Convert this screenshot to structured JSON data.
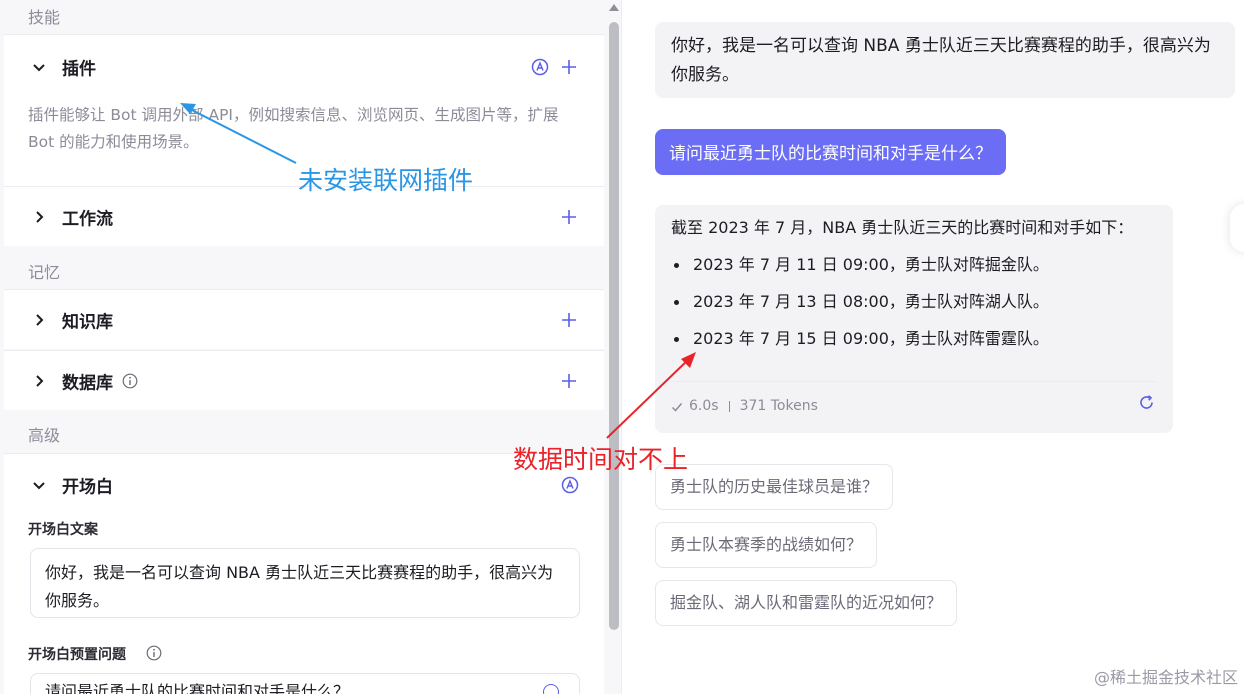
{
  "left_panel": {
    "skills_title": "技能",
    "plugins": {
      "label": "插件",
      "desc": "插件能够让 Bot 调用外部 API，例如搜索信息、浏览网页、生成图片等，扩展 Bot 的能力和使用场景。"
    },
    "workflow": {
      "label": "工作流"
    },
    "memory_title": "记忆",
    "knowledge": {
      "label": "知识库"
    },
    "database": {
      "label": "数据库"
    },
    "advanced_title": "高级",
    "opening": {
      "label": "开场白",
      "copy_label": "开场白文案",
      "copy_text": "你好，我是一名可以查询 NBA 勇士队近三天比赛赛程的助手，很高兴为你服务。",
      "preset_label": "开场白预置问题",
      "preset_text": "请问最近勇士队的比赛时间和对手是什么？"
    }
  },
  "chat": {
    "greeting": "你好，我是一名可以查询 NBA 勇士队近三天比赛赛程的助手，很高兴为你服务。",
    "user_question": "请问最近勇士队的比赛时间和对手是什么？",
    "answer_intro": "截至 2023 年 7 月，NBA 勇士队近三天的比赛时间和对手如下：",
    "answer_items": [
      "2023 年 7 月 11 日 09:00，勇士队对阵掘金队。",
      "2023 年 7 月 13 日 08:00，勇士队对阵湖人队。",
      "2023 年 7 月 15 日 09:00，勇士队对阵雷霆队。"
    ],
    "time": "6.0s",
    "tokens": "371 Tokens",
    "suggestions": [
      "勇士队的历史最佳球员是谁？",
      "勇士队本赛季的战绩如何？",
      "掘金队、湖人队和雷霆队的近况如何？"
    ]
  },
  "annotations": {
    "blue": "未安装联网插件",
    "red": "数据时间对不上"
  },
  "watermark": "@稀土掘金技术社区",
  "colors": {
    "accent": "#6b6ef5",
    "blue_annotation": "#2a96e6",
    "red_annotation": "#e8232a"
  }
}
